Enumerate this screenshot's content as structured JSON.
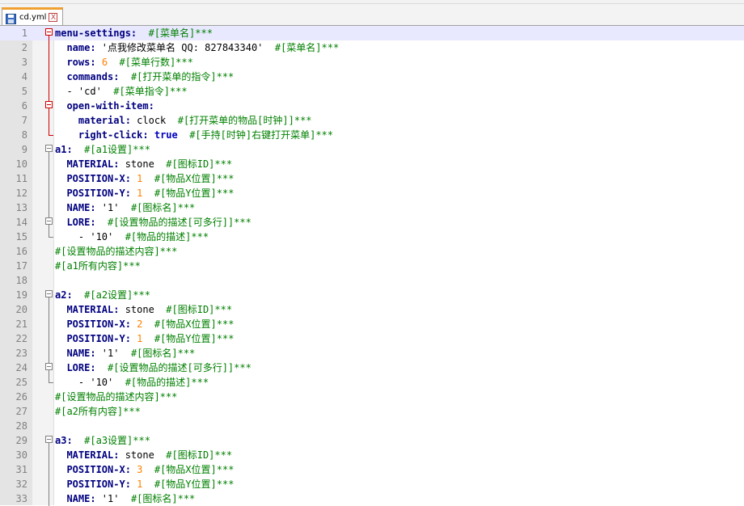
{
  "tab": {
    "file_name": "cd.yml",
    "close_label": "X"
  },
  "lines": [
    {
      "n": "1",
      "fold": "box-red",
      "current": true,
      "segs": [
        [
          "k",
          "menu-settings:"
        ],
        [
          "s",
          "  "
        ],
        [
          "c",
          "#[菜单名]***"
        ]
      ]
    },
    {
      "n": "2",
      "fold": "line-red",
      "segs": [
        [
          "s",
          "  "
        ],
        [
          "k",
          "name:"
        ],
        [
          "s",
          " '点我修改菜单名 QQ: 827843340'  "
        ],
        [
          "c",
          "#[菜单名]***"
        ]
      ]
    },
    {
      "n": "3",
      "fold": "line-red",
      "segs": [
        [
          "s",
          "  "
        ],
        [
          "k",
          "rows:"
        ],
        [
          "s",
          " "
        ],
        [
          "n",
          "6"
        ],
        [
          "s",
          "  "
        ],
        [
          "c",
          "#[菜单行数]***"
        ]
      ]
    },
    {
      "n": "4",
      "fold": "line-red",
      "segs": [
        [
          "s",
          "  "
        ],
        [
          "k",
          "commands:"
        ],
        [
          "s",
          "  "
        ],
        [
          "c",
          "#[打开菜单的指令]***"
        ]
      ]
    },
    {
      "n": "5",
      "fold": "line-red",
      "segs": [
        [
          "s",
          "  - 'cd'  "
        ],
        [
          "c",
          "#[菜单指令]***"
        ]
      ]
    },
    {
      "n": "6",
      "fold": "box-red-mid",
      "segs": [
        [
          "s",
          "  "
        ],
        [
          "k",
          "open-with-item:"
        ]
      ]
    },
    {
      "n": "7",
      "fold": "line-red",
      "segs": [
        [
          "s",
          "    "
        ],
        [
          "k",
          "material:"
        ],
        [
          "s",
          " clock  "
        ],
        [
          "c",
          "#[打开菜单的物品[时钟]]***"
        ]
      ]
    },
    {
      "n": "8",
      "fold": "end-red",
      "segs": [
        [
          "s",
          "    "
        ],
        [
          "k",
          "right-click:"
        ],
        [
          "s",
          " "
        ],
        [
          "b",
          "true"
        ],
        [
          "s",
          "  "
        ],
        [
          "c",
          "#[手持[时钟]右键打开菜单]***"
        ]
      ]
    },
    {
      "n": "9",
      "fold": "box",
      "segs": [
        [
          "k",
          "a1:"
        ],
        [
          "s",
          "  "
        ],
        [
          "c",
          "#[a1设置]***"
        ]
      ]
    },
    {
      "n": "10",
      "fold": "line",
      "segs": [
        [
          "s",
          "  "
        ],
        [
          "k",
          "MATERIAL:"
        ],
        [
          "s",
          " stone  "
        ],
        [
          "c",
          "#[图标ID]***"
        ]
      ]
    },
    {
      "n": "11",
      "fold": "line",
      "segs": [
        [
          "s",
          "  "
        ],
        [
          "k",
          "POSITION-X:"
        ],
        [
          "s",
          " "
        ],
        [
          "n",
          "1"
        ],
        [
          "s",
          "  "
        ],
        [
          "c",
          "#[物品X位置]***"
        ]
      ]
    },
    {
      "n": "12",
      "fold": "line",
      "segs": [
        [
          "s",
          "  "
        ],
        [
          "k",
          "POSITION-Y:"
        ],
        [
          "s",
          " "
        ],
        [
          "n",
          "1"
        ],
        [
          "s",
          "  "
        ],
        [
          "c",
          "#[物品Y位置]***"
        ]
      ]
    },
    {
      "n": "13",
      "fold": "line",
      "segs": [
        [
          "s",
          "  "
        ],
        [
          "k",
          "NAME:"
        ],
        [
          "s",
          " '1'  "
        ],
        [
          "c",
          "#[图标名]***"
        ]
      ]
    },
    {
      "n": "14",
      "fold": "box-mid",
      "segs": [
        [
          "s",
          "  "
        ],
        [
          "k",
          "LORE:"
        ],
        [
          "s",
          "  "
        ],
        [
          "c",
          "#[设置物品的描述[可多行]]***"
        ]
      ]
    },
    {
      "n": "15",
      "fold": "end",
      "segs": [
        [
          "s",
          "    - '10'  "
        ],
        [
          "c",
          "#[物品的描述]***"
        ]
      ]
    },
    {
      "n": "16",
      "fold": "none",
      "segs": [
        [
          "c",
          "#[设置物品的描述内容]***"
        ]
      ]
    },
    {
      "n": "17",
      "fold": "none",
      "segs": [
        [
          "c",
          "#[a1所有内容]***"
        ]
      ]
    },
    {
      "n": "18",
      "fold": "none",
      "segs": []
    },
    {
      "n": "19",
      "fold": "box",
      "segs": [
        [
          "k",
          "a2:"
        ],
        [
          "s",
          "  "
        ],
        [
          "c",
          "#[a2设置]***"
        ]
      ]
    },
    {
      "n": "20",
      "fold": "line",
      "segs": [
        [
          "s",
          "  "
        ],
        [
          "k",
          "MATERIAL:"
        ],
        [
          "s",
          " stone  "
        ],
        [
          "c",
          "#[图标ID]***"
        ]
      ]
    },
    {
      "n": "21",
      "fold": "line",
      "segs": [
        [
          "s",
          "  "
        ],
        [
          "k",
          "POSITION-X:"
        ],
        [
          "s",
          " "
        ],
        [
          "n",
          "2"
        ],
        [
          "s",
          "  "
        ],
        [
          "c",
          "#[物品X位置]***"
        ]
      ]
    },
    {
      "n": "22",
      "fold": "line",
      "segs": [
        [
          "s",
          "  "
        ],
        [
          "k",
          "POSITION-Y:"
        ],
        [
          "s",
          " "
        ],
        [
          "n",
          "1"
        ],
        [
          "s",
          "  "
        ],
        [
          "c",
          "#[物品Y位置]***"
        ]
      ]
    },
    {
      "n": "23",
      "fold": "line",
      "segs": [
        [
          "s",
          "  "
        ],
        [
          "k",
          "NAME:"
        ],
        [
          "s",
          " '1'  "
        ],
        [
          "c",
          "#[图标名]***"
        ]
      ]
    },
    {
      "n": "24",
      "fold": "box-mid",
      "segs": [
        [
          "s",
          "  "
        ],
        [
          "k",
          "LORE:"
        ],
        [
          "s",
          "  "
        ],
        [
          "c",
          "#[设置物品的描述[可多行]]***"
        ]
      ]
    },
    {
      "n": "25",
      "fold": "end",
      "segs": [
        [
          "s",
          "    - '10'  "
        ],
        [
          "c",
          "#[物品的描述]***"
        ]
      ]
    },
    {
      "n": "26",
      "fold": "none",
      "segs": [
        [
          "c",
          "#[设置物品的描述内容]***"
        ]
      ]
    },
    {
      "n": "27",
      "fold": "none",
      "segs": [
        [
          "c",
          "#[a2所有内容]***"
        ]
      ]
    },
    {
      "n": "28",
      "fold": "none",
      "segs": []
    },
    {
      "n": "29",
      "fold": "box",
      "segs": [
        [
          "k",
          "a3:"
        ],
        [
          "s",
          "  "
        ],
        [
          "c",
          "#[a3设置]***"
        ]
      ]
    },
    {
      "n": "30",
      "fold": "line",
      "segs": [
        [
          "s",
          "  "
        ],
        [
          "k",
          "MATERIAL:"
        ],
        [
          "s",
          " stone  "
        ],
        [
          "c",
          "#[图标ID]***"
        ]
      ]
    },
    {
      "n": "31",
      "fold": "line",
      "segs": [
        [
          "s",
          "  "
        ],
        [
          "k",
          "POSITION-X:"
        ],
        [
          "s",
          " "
        ],
        [
          "n",
          "3"
        ],
        [
          "s",
          "  "
        ],
        [
          "c",
          "#[物品X位置]***"
        ]
      ]
    },
    {
      "n": "32",
      "fold": "line",
      "segs": [
        [
          "s",
          "  "
        ],
        [
          "k",
          "POSITION-Y:"
        ],
        [
          "s",
          " "
        ],
        [
          "n",
          "1"
        ],
        [
          "s",
          "  "
        ],
        [
          "c",
          "#[物品Y位置]***"
        ]
      ]
    },
    {
      "n": "33",
      "fold": "line",
      "segs": [
        [
          "s",
          "  "
        ],
        [
          "k",
          "NAME:"
        ],
        [
          "s",
          " '1'  "
        ],
        [
          "c",
          "#[图标名]***"
        ]
      ]
    }
  ]
}
